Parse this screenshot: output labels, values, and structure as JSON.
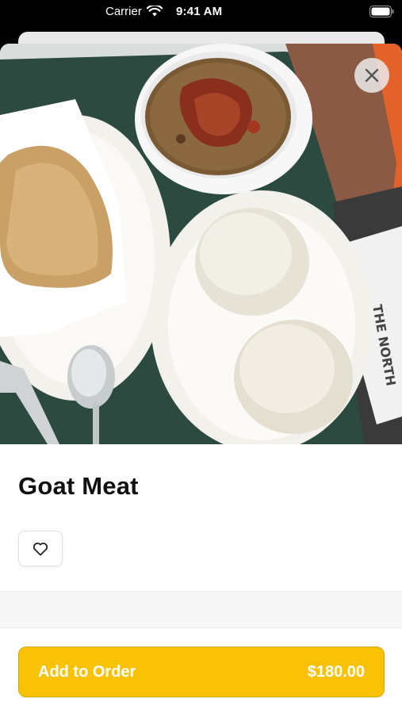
{
  "status_bar": {
    "carrier": "Carrier",
    "time": "9:41 AM",
    "icons": [
      "wifi-icon",
      "battery-icon"
    ]
  },
  "item": {
    "photo": "food-photo",
    "name": "Goat Meat",
    "favorite_icon": "heart-icon"
  },
  "close_icon": "close-icon",
  "order_button": {
    "label": "Add to Order",
    "price": "$180.00",
    "color": "#f9c207"
  }
}
